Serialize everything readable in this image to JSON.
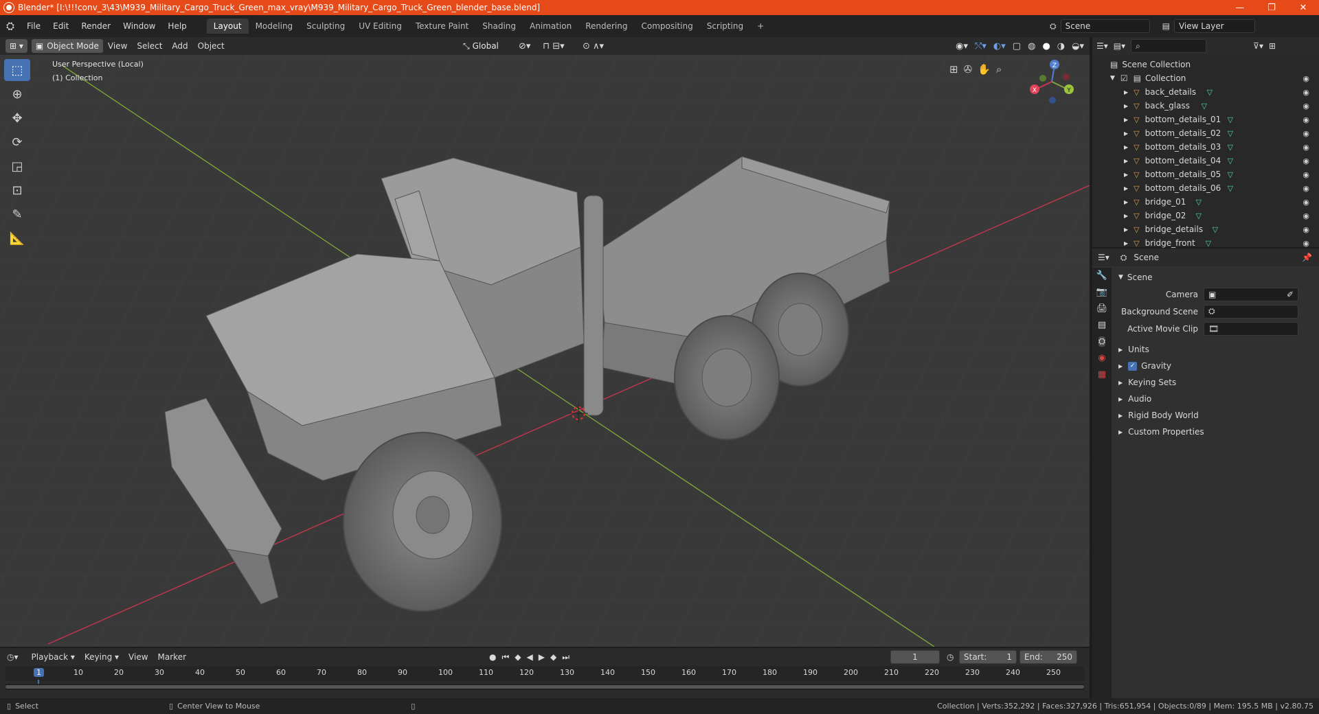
{
  "window": {
    "title": "Blender* [I:\\!!!conv_3\\43\\M939_Military_Cargo_Truck_Green_max_vray\\M939_Military_Cargo_Truck_Green_blender_base.blend]",
    "min": "—",
    "max": "❐",
    "close": "✕"
  },
  "menu": [
    "File",
    "Edit",
    "Render",
    "Window",
    "Help"
  ],
  "workspaces": [
    "Layout",
    "Modeling",
    "Sculpting",
    "UV Editing",
    "Texture Paint",
    "Shading",
    "Animation",
    "Rendering",
    "Compositing",
    "Scripting"
  ],
  "workspace_add": "+",
  "scene_field": "Scene",
  "view_layer_field": "View Layer",
  "viewport": {
    "mode": "Object Mode",
    "menus": [
      "View",
      "Select",
      "Add",
      "Object"
    ],
    "transform": "Global",
    "overlay_line1": "User Perspective (Local)",
    "overlay_line2": "(1) Collection",
    "gizmo": {
      "x": "X",
      "y": "Y",
      "z": "Z"
    }
  },
  "outliner": {
    "search_placeholder": "",
    "root": "Scene Collection",
    "collection": "Collection",
    "items": [
      "back_details",
      "back_glass",
      "bottom_details_01",
      "bottom_details_02",
      "bottom_details_03",
      "bottom_details_04",
      "bottom_details_05",
      "bottom_details_06",
      "bridge_01",
      "bridge_02",
      "bridge_details",
      "bridge_front"
    ]
  },
  "properties": {
    "header": "Scene",
    "section": "Scene",
    "camera_label": "Camera",
    "bg_scene_label": "Background Scene",
    "movie_clip_label": "Active Movie Clip",
    "panels": [
      "Units",
      "Gravity",
      "Keying Sets",
      "Audio",
      "Rigid Body World",
      "Custom Properties"
    ]
  },
  "timeline": {
    "menus": [
      "Playback",
      "Keying",
      "View",
      "Marker"
    ],
    "frame": "1",
    "start_label": "Start:",
    "start": "1",
    "end_label": "End:",
    "end": "250",
    "ticks": [
      "1",
      "10",
      "20",
      "30",
      "40",
      "50",
      "60",
      "70",
      "80",
      "90",
      "100",
      "110",
      "120",
      "130",
      "140",
      "150",
      "160",
      "170",
      "180",
      "190",
      "200",
      "210",
      "220",
      "230",
      "240",
      "250"
    ]
  },
  "status": {
    "select": "Select",
    "center": "Center View to Mouse",
    "stats": "Collection | Verts:352,292 | Faces:327,926 | Tris:651,954 | Objects:0/89 | Mem: 195.5 MB | v2.80.75"
  },
  "colors": {
    "title_bar": "#e64a19",
    "accent": "#4772b3",
    "grid_x": "#c4364e",
    "grid_y": "#7ea43a"
  }
}
